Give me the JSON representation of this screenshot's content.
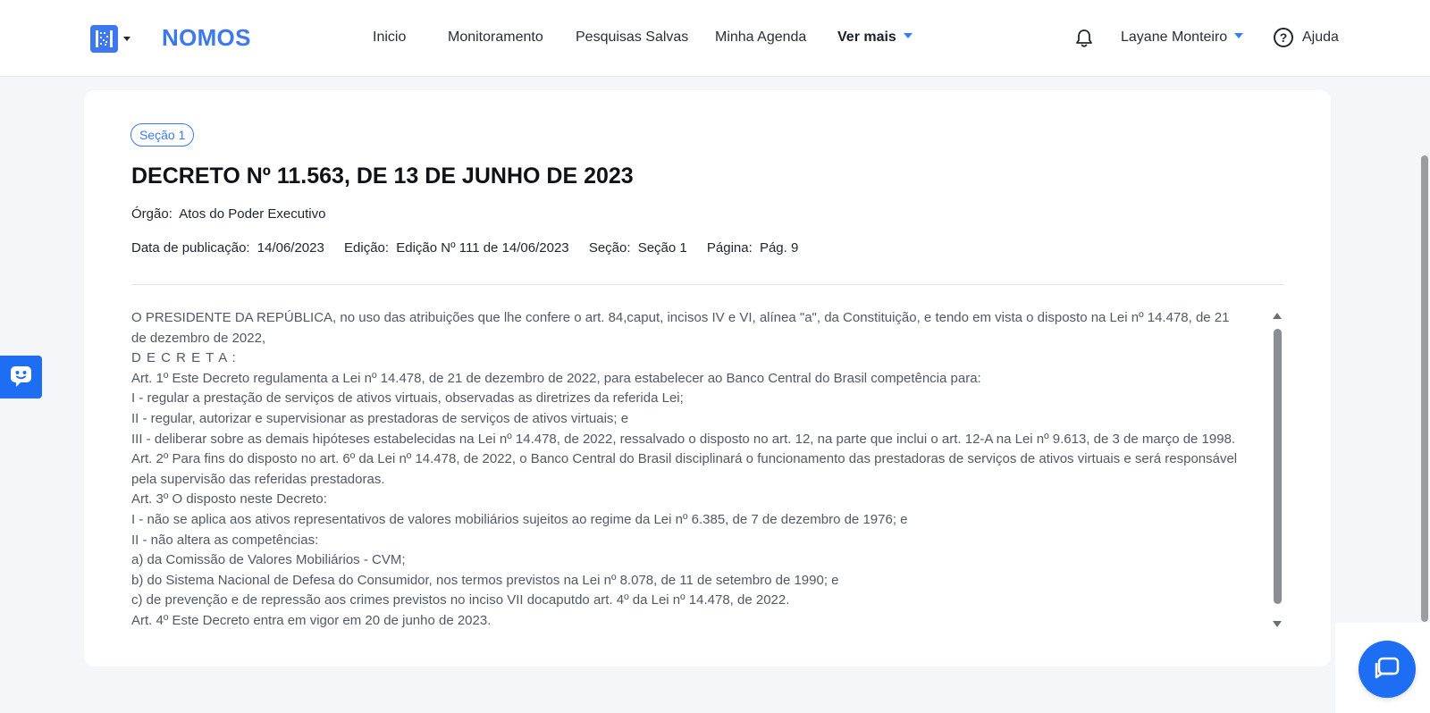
{
  "header": {
    "brand": "NOMOS",
    "nav": [
      {
        "label": "Inicio"
      },
      {
        "label": "Monitoramento"
      },
      {
        "label": "Pesquisas Salvas"
      },
      {
        "label": "Minha Agenda"
      },
      {
        "label": "Ver mais"
      }
    ],
    "user_name": "Layane Monteiro",
    "help_label": "Ajuda"
  },
  "document": {
    "section_badge": "Seção 1",
    "title": "DECRETO Nº 11.563, DE 13 DE JUNHO DE 2023",
    "orgao_label": "Órgão:",
    "orgao_value": "Atos do Poder Executivo",
    "publication_label": "Data de publicação:",
    "publication_value": "14/06/2023",
    "edition_label": "Edição:",
    "edition_value": "Edição Nº 111 de 14/06/2023",
    "section_label": "Seção:",
    "section_value": "Seção 1",
    "page_label": "Página:",
    "page_value": "Pág. 9",
    "body": [
      "O PRESIDENTE DA REPÚBLICA, no uso das atribuições que lhe confere o art. 84,caput, incisos IV e VI, alínea \"a\", da Constituição, e tendo em vista o disposto na Lei nº 14.478, de 21 de dezembro de 2022,",
      "D E C R E T A :",
      "Art. 1º Este Decreto regulamenta a Lei nº 14.478, de 21 de dezembro de 2022, para estabelecer ao Banco Central do Brasil competência para:",
      "I - regular a prestação de serviços de ativos virtuais, observadas as diretrizes da referida Lei;",
      "II - regular, autorizar e supervisionar as prestadoras de serviços de ativos virtuais; e",
      "III - deliberar sobre as demais hipóteses estabelecidas na Lei nº 14.478, de 2022, ressalvado o disposto no art. 12, na parte que inclui o art. 12-A na Lei nº 9.613, de 3 de março de 1998.",
      "Art. 2º Para fins do disposto no art. 6º da Lei nº 14.478, de 2022, o Banco Central do Brasil disciplinará o funcionamento das prestadoras de serviços de ativos virtuais e será responsável pela supervisão das referidas prestadoras.",
      "Art. 3º O disposto neste Decreto:",
      "I - não se aplica aos ativos representativos de valores mobiliários sujeitos ao regime da Lei nº 6.385, de 7 de dezembro de 1976; e",
      "II - não altera as competências:",
      "a) da Comissão de Valores Mobiliários - CVM;",
      "b) do Sistema Nacional de Defesa do Consumidor, nos termos previstos na Lei nº 8.078, de 11 de setembro de 1990; e",
      "c) de prevenção e de repressão aos crimes previstos no inciso VII docaputdo art. 4º da Lei nº 14.478, de 2022.",
      "Art. 4º Este Decreto entra em vigor em 20 de junho de 2023."
    ]
  },
  "colors": {
    "brand_blue": "#3c78ef",
    "action_blue": "#1e6ef3"
  },
  "icons": {
    "app": "grid-app-icon",
    "notification": "bell-icon",
    "help": "question-circle-icon",
    "feedback": "chat-robot-icon",
    "chat": "chat-bubble-icon"
  }
}
